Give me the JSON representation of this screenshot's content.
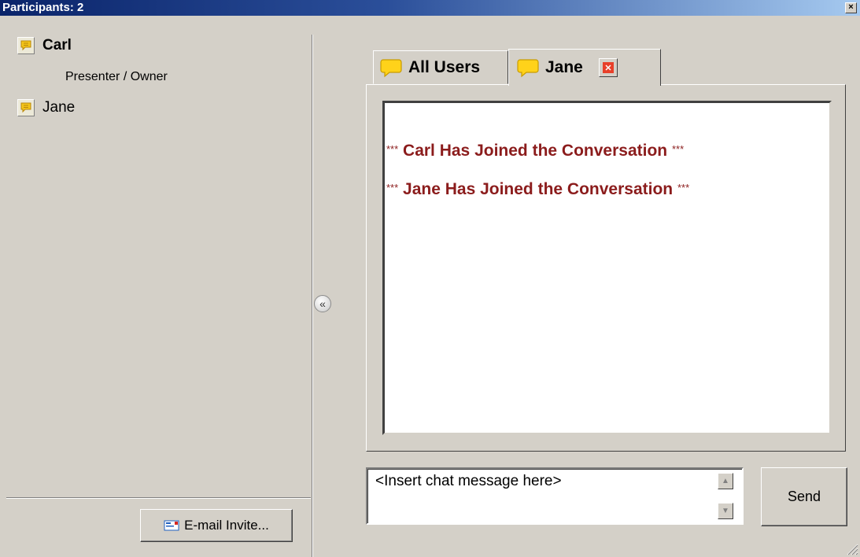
{
  "window": {
    "title": "Participants: 2",
    "close_glyph": "×"
  },
  "participants": [
    {
      "name": "Carl",
      "role": "Presenter / Owner",
      "icon": "chat-bubble-icon"
    },
    {
      "name": "Jane",
      "icon": "chat-bubble-icon"
    }
  ],
  "email_invite": {
    "label": "E-mail Invite...",
    "icon": "email-card-icon"
  },
  "collapse": {
    "glyph": "«"
  },
  "tabs": [
    {
      "label": "All Users",
      "icon": "chat-bubble-icon"
    },
    {
      "label": "Jane",
      "icon": "chat-bubble-icon",
      "closable": true
    }
  ],
  "chat_log": [
    {
      "prefix": "***",
      "text": " Carl Has Joined the Conversation ",
      "suffix": "***"
    },
    {
      "prefix": "***",
      "text": " Jane Has Joined the Conversation ",
      "suffix": "***"
    }
  ],
  "message_input": {
    "value": "<Insert chat message here>"
  },
  "send": {
    "label": "Send"
  },
  "colors": {
    "system_message": "#8b1c1c",
    "titlebar": "#0a246a",
    "face": "#d4d0c8"
  }
}
